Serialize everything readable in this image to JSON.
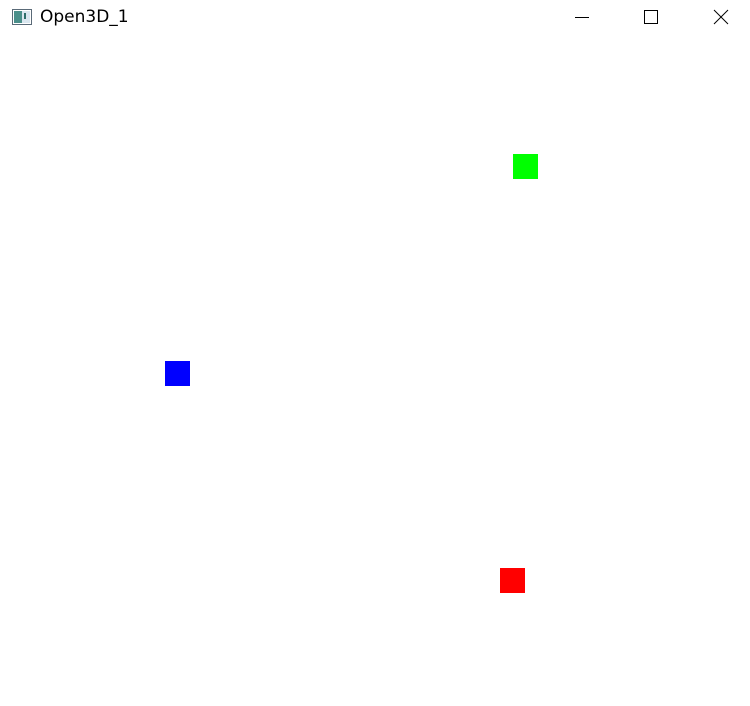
{
  "window": {
    "title": "Open3D_1"
  },
  "titlebar": {
    "icon": "app-window-icon",
    "controls": [
      {
        "name": "minimize",
        "icon": "minimize-icon"
      },
      {
        "name": "maximize",
        "icon": "maximize-icon"
      },
      {
        "name": "close",
        "icon": "close-icon"
      }
    ]
  },
  "viewer": {
    "background": "#ffffff",
    "points": [
      {
        "name": "green-point",
        "color": "#00ff00"
      },
      {
        "name": "blue-point",
        "color": "#0000ff"
      },
      {
        "name": "red-point",
        "color": "#ff0000"
      }
    ]
  }
}
